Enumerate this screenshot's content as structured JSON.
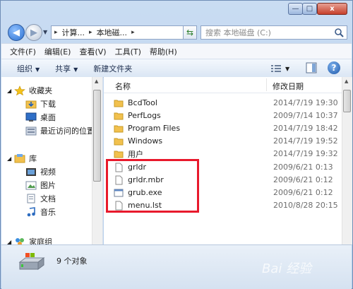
{
  "window": {
    "controls": {
      "minimize": "—",
      "maximize": "□",
      "close": "x"
    }
  },
  "navbar": {
    "back_glyph": "◀",
    "forward_glyph": "▶",
    "breadcrumbs": [
      "计算...",
      "本地磁..."
    ],
    "search_placeholder": "搜索 本地磁盘 (C:)"
  },
  "menubar": {
    "items": [
      "文件(F)",
      "编辑(E)",
      "查看(V)",
      "工具(T)",
      "帮助(H)"
    ]
  },
  "toolbar": {
    "organize": "组织",
    "share": "共享",
    "new_folder": "新建文件夹",
    "help": "?"
  },
  "nav": {
    "favorites": "收藏夹",
    "favorites_items": [
      "下载",
      "桌面",
      "最近访问的位置"
    ],
    "libraries": "库",
    "library_items": [
      "视频",
      "图片",
      "文档",
      "音乐"
    ],
    "homegroup": "家庭组"
  },
  "columns": {
    "name": "名称",
    "date": "修改日期"
  },
  "files": [
    {
      "name": "BcdTool",
      "date": "2014/7/19 19:30",
      "type": "folder"
    },
    {
      "name": "PerfLogs",
      "date": "2009/7/14 10:37",
      "type": "folder"
    },
    {
      "name": "Program Files",
      "date": "2014/7/19 18:42",
      "type": "folder"
    },
    {
      "name": "Windows",
      "date": "2014/7/19 19:52",
      "type": "folder"
    },
    {
      "name": "用户",
      "date": "2014/7/19 19:32",
      "type": "folder"
    },
    {
      "name": "grldr",
      "date": "2009/6/21 0:13",
      "type": "file"
    },
    {
      "name": "grldr.mbr",
      "date": "2009/6/21 0:12",
      "type": "file"
    },
    {
      "name": "grub.exe",
      "date": "2009/6/21 0:12",
      "type": "exe"
    },
    {
      "name": "menu.lst",
      "date": "2010/8/28 20:15",
      "type": "file"
    }
  ],
  "status": {
    "count": "9 个对象"
  },
  "watermark": "Bai 经验",
  "colors": {
    "highlight": "#e8192c",
    "folder": "#f2c14e"
  }
}
